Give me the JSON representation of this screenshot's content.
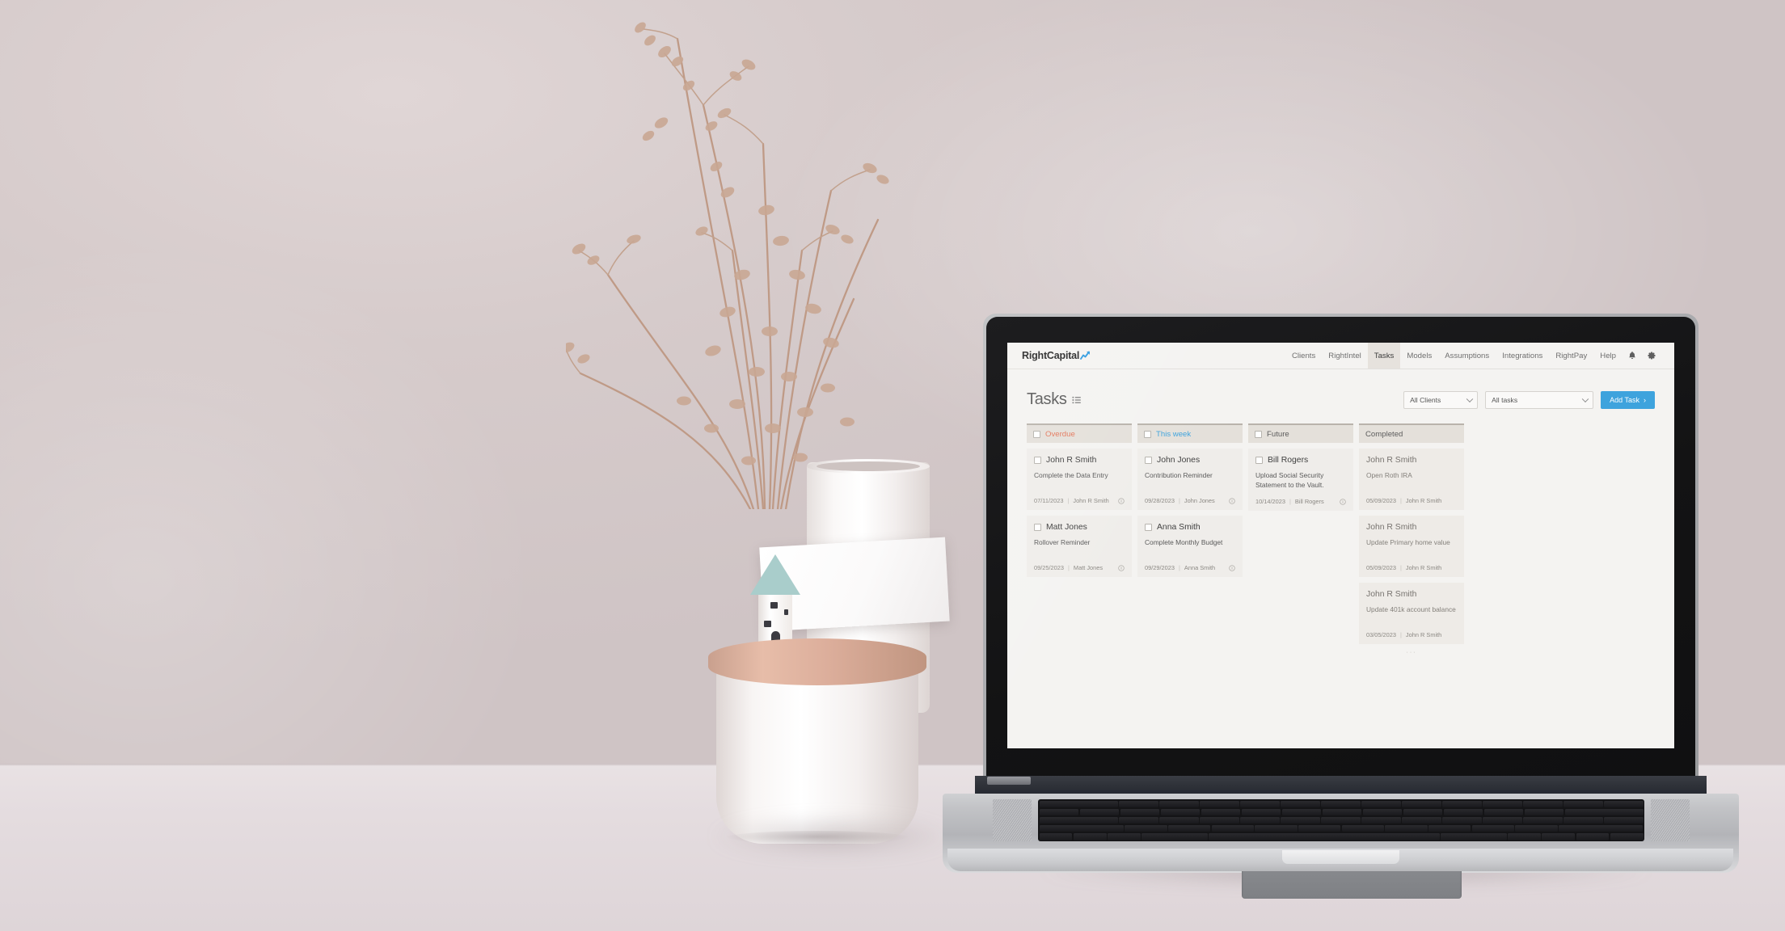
{
  "app": {
    "brand": "RightCapital",
    "brand_accent_color": "#2f9be0",
    "nav": [
      {
        "label": "Clients",
        "active": false
      },
      {
        "label": "RightIntel",
        "active": false
      },
      {
        "label": "Tasks",
        "active": true
      },
      {
        "label": "Models",
        "active": false
      },
      {
        "label": "Assumptions",
        "active": false
      },
      {
        "label": "Integrations",
        "active": false
      },
      {
        "label": "RightPay",
        "active": false
      },
      {
        "label": "Help",
        "active": false
      }
    ],
    "nav_icons": [
      {
        "name": "notification-bell-icon"
      },
      {
        "name": "settings-gear-icon"
      }
    ],
    "page_title": "Tasks",
    "filters": {
      "client_filter": {
        "value": "All Clients"
      },
      "task_filter": {
        "value": "All tasks"
      }
    },
    "add_task_label": "Add Task",
    "add_task_chevron": "›",
    "accent_color": "#3ea3dd",
    "overdue_color": "#e3775b",
    "board": [
      {
        "id": "overdue",
        "title": "Overdue",
        "has_checkbox": true,
        "style": "overdue",
        "tasks": [
          {
            "client": "John R Smith",
            "description": "Complete the Data Entry",
            "date": "07/11/2023",
            "owner": "John R Smith",
            "checkbox": true,
            "completed": false
          },
          {
            "client": "Matt Jones",
            "description": "Rollover Reminder",
            "date": "09/25/2023",
            "owner": "Matt Jones",
            "checkbox": true,
            "completed": false
          }
        ]
      },
      {
        "id": "this-week",
        "title": "This week",
        "has_checkbox": true,
        "style": "thisweek",
        "tasks": [
          {
            "client": "John Jones",
            "description": "Contribution Reminder",
            "date": "09/28/2023",
            "owner": "John Jones",
            "checkbox": true,
            "completed": false
          },
          {
            "client": "Anna Smith",
            "description": "Complete Monthly Budget",
            "date": "09/29/2023",
            "owner": "Anna Smith",
            "checkbox": true,
            "completed": false
          }
        ]
      },
      {
        "id": "future",
        "title": "Future",
        "has_checkbox": true,
        "style": "",
        "tasks": [
          {
            "client": "Bill Rogers",
            "description": "Upload Social Security Statement to the Vault.",
            "date": "10/14/2023",
            "owner": "Bill Rogers",
            "checkbox": true,
            "completed": false
          }
        ]
      },
      {
        "id": "completed",
        "title": "Completed",
        "has_checkbox": false,
        "style": "",
        "tasks": [
          {
            "client": "John R Smith",
            "description": "Open Roth IRA",
            "date": "05/09/2023",
            "owner": "John R Smith",
            "checkbox": false,
            "completed": true
          },
          {
            "client": "John R Smith",
            "description": "Update Primary home value",
            "date": "05/09/2023",
            "owner": "John R Smith",
            "checkbox": false,
            "completed": true
          },
          {
            "client": "John R Smith",
            "description": "Update 401k account balance",
            "date": "03/05/2023",
            "owner": "John R Smith",
            "checkbox": false,
            "completed": true
          }
        ]
      }
    ]
  },
  "scene": {
    "description": "Open silver laptop on a white table against a soft pink-grey wall, with dried flowers in a white vase, a ceramic jar with terracotta lid, a small house figurine and a blank white card",
    "wall_color": "#d8cdcd",
    "table_color": "#e6dee0",
    "vase_color": "#ffffff",
    "jar_lid_color": "#dcae9b",
    "house_roof_color": "#a9cdcb",
    "laptop_body_color": "#bdbec1"
  }
}
